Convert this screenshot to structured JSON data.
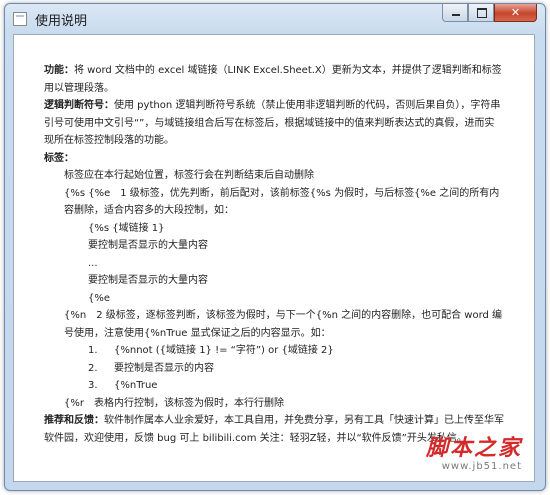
{
  "window": {
    "title": "使用说明",
    "minimize_glyph": "",
    "maximize_glyph": "",
    "close_glyph": "✕"
  },
  "content": {
    "p1_label": "功能：",
    "p1_text": "将 word 文档中的 excel 域链接（LINK Excel.Sheet.X）更新为文本，并提供了逻辑判断和标签用以管理段落。",
    "p2_label": "逻辑判断符号：",
    "p2_text": "使用 python 逻辑判断符号系统（禁止使用非逻辑判断的代码，否则后果自负），字符串引号可使用中文引号“”，与域链接组合后写在标签后，根据域链接中的值来判断表达式的真假，进而实现所在标签控制段落的功能。",
    "p3_label": "标签：",
    "p4": "标签应在本行起始位置，标签行会在判断结束后自动删除",
    "p5": "{%s {%e　1 级标签，优先判断，前后配对，该前标签{%s 为假时，与后标签{%e 之间的所有内容删除，适合内容多的大段控制，如：",
    "ex1_line1": "{%s {域链接 1}",
    "ex1_line2": "要控制是否显示的大量内容",
    "ex1_line3": "...",
    "ex1_line4": "要控制是否显示的大量内容",
    "ex1_line5": "{%e",
    "p6": "{%n　2 级标签，逐标签判断，该标签为假时，与下一个{%n 之间的内容删除，也可配合 word 编号使用，注意使用{%nTrue 显式保证之后的内容显示。如：",
    "ex2": [
      {
        "num": "1.",
        "text": "{%nnot ({域链接 1} != “字符”) or {域链接 2}"
      },
      {
        "num": "2.",
        "text": "要控制是否显示的内容"
      },
      {
        "num": "3.",
        "text": "{%nTrue"
      }
    ],
    "p7": "{%r　表格内行控制，该标签为假时，本行行删除",
    "p8_label": "推荐和反馈：",
    "p8_text": "软件制作属本人业余爱好，本工具自用，并免费分享，另有工具「快速计算」已上传至华军软件园，欢迎使用，反馈 bug 可上 bilibili.com 关注：轻羽Z轻，并以“软件反馈”开头发私信。"
  },
  "watermark": {
    "main": "脚本之家",
    "sub": "www.jb51.net"
  }
}
